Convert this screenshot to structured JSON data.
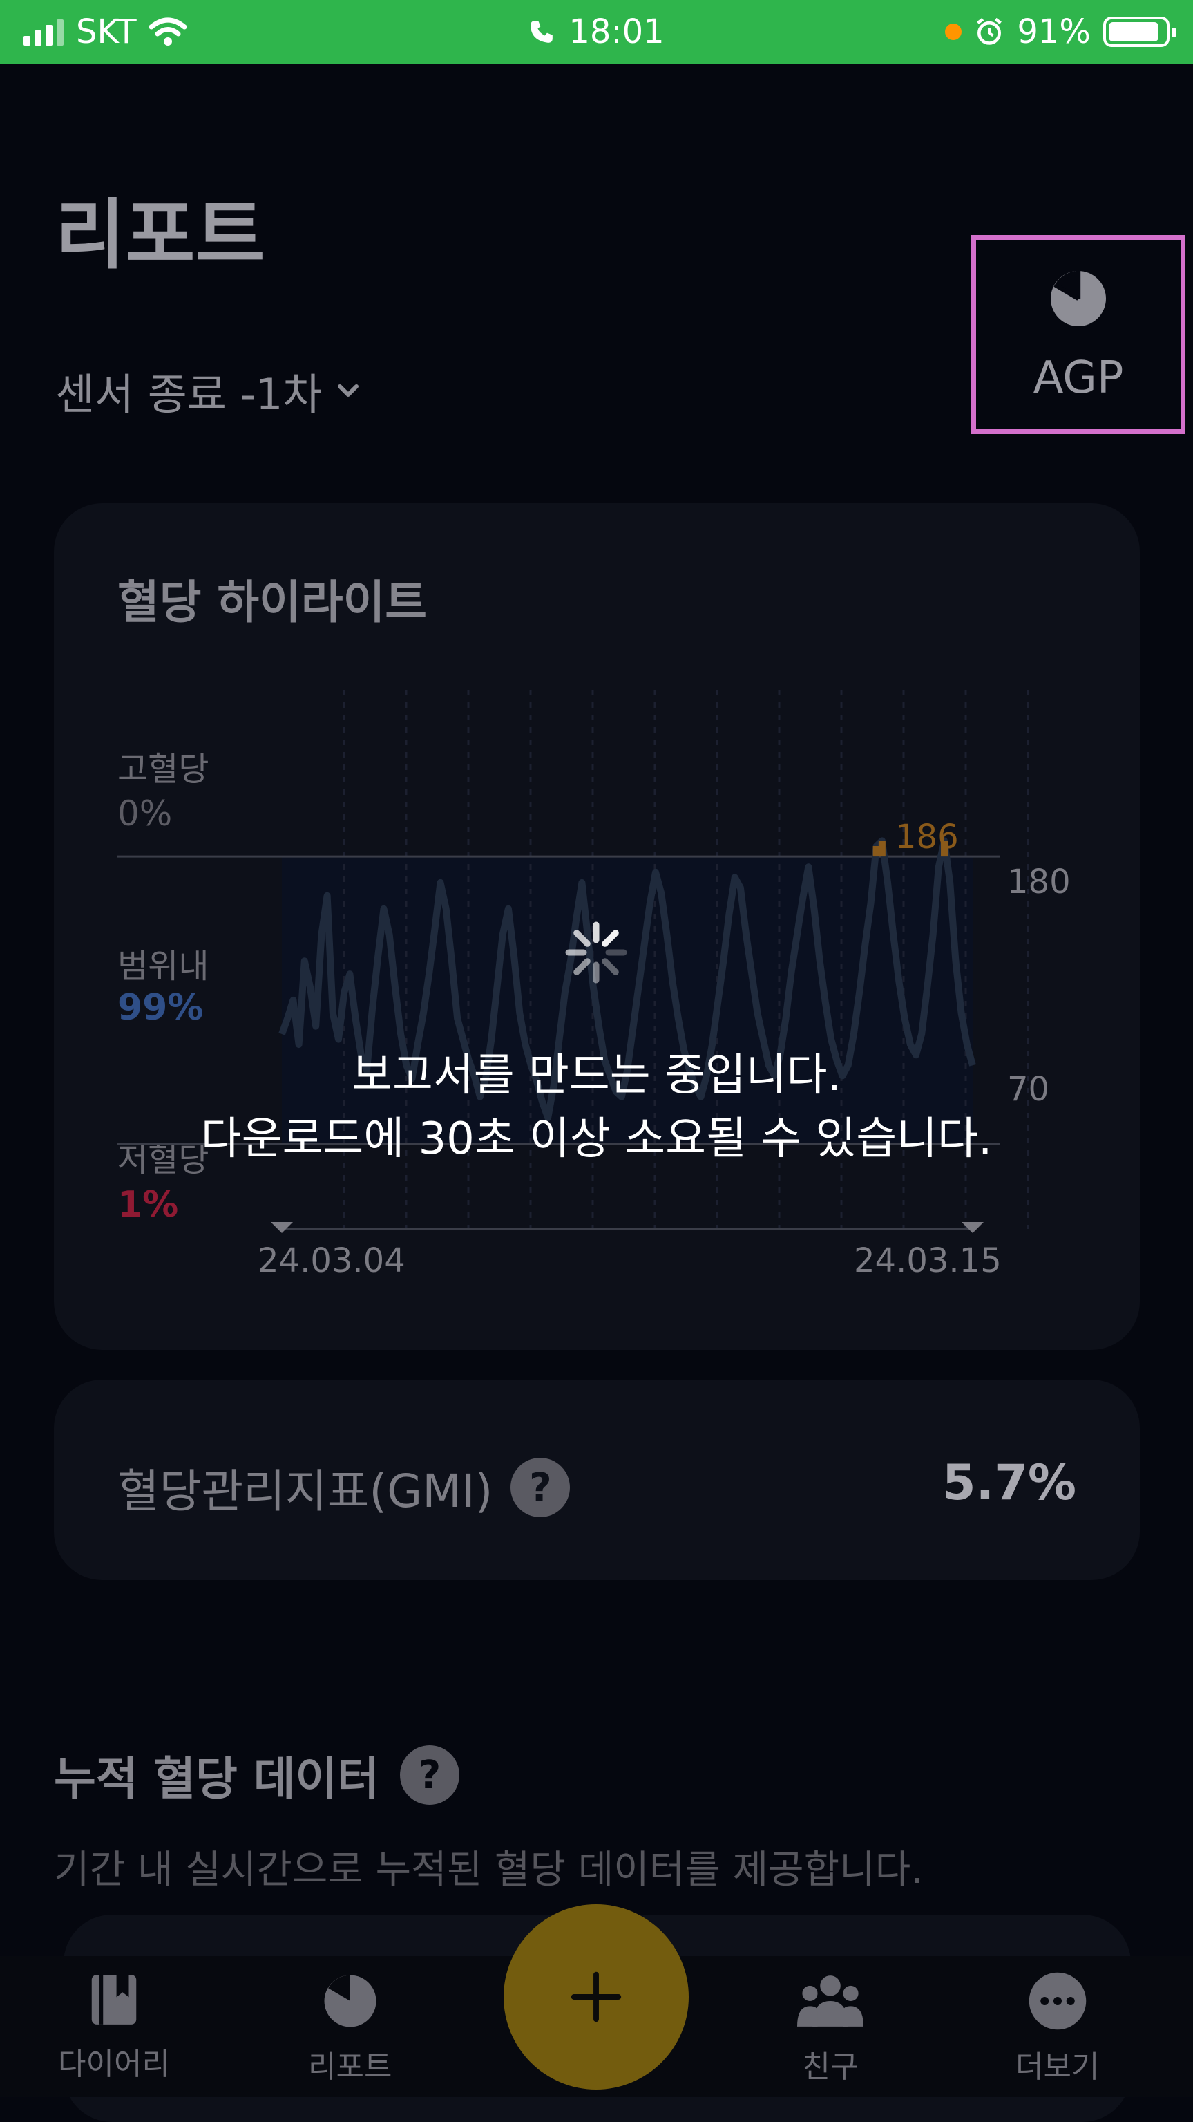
{
  "status_bar": {
    "carrier": "SKT",
    "time": "18:01",
    "battery": "91%"
  },
  "header": {
    "title": "리포트",
    "period": "센서 종료 -1차",
    "agp_label": "AGP"
  },
  "highlight": {
    "title": "혈당 하이라이트",
    "high_label": "고혈당",
    "high_value": "0%",
    "in_range_label": "범위내",
    "in_range_value": "99%",
    "low_label": "저혈당",
    "low_value": "1%",
    "upper_line": "180",
    "lower_line": "70",
    "peak_label": "186",
    "start_date": "24.03.04",
    "end_date": "24.03.15",
    "colors": {
      "in_range": "#2f4f88",
      "low": "#8f1a33",
      "peak": "#8a5a1a"
    }
  },
  "chart_data": {
    "type": "line",
    "title": "혈당 하이라이트",
    "x_range": [
      "24.03.04",
      "24.03.15"
    ],
    "reference_lines": [
      180,
      70
    ],
    "annotations": [
      "186"
    ],
    "values": [
      112,
      118,
      125,
      108,
      140,
      130,
      115,
      150,
      165,
      120,
      110,
      128,
      135,
      118,
      104,
      98,
      122,
      142,
      160,
      150,
      130,
      112,
      100,
      95,
      108,
      120,
      135,
      152,
      170,
      160,
      140,
      118,
      110,
      102,
      96,
      88,
      95,
      110,
      130,
      150,
      160,
      142,
      120,
      108,
      100,
      94,
      86,
      80,
      92,
      110,
      128,
      140,
      156,
      170,
      150,
      130,
      115,
      102,
      96,
      90,
      88,
      98,
      114,
      130,
      146,
      162,
      174,
      166,
      150,
      132,
      118,
      106,
      98,
      92,
      88,
      96,
      108,
      124,
      140,
      158,
      172,
      168,
      150,
      135,
      120,
      110,
      100,
      96,
      104,
      118,
      136,
      150,
      164,
      176,
      160,
      140,
      124,
      110,
      102,
      96,
      100,
      112,
      128,
      146,
      162,
      184,
      186,
      170,
      150,
      132,
      118,
      108,
      104,
      112,
      130,
      150,
      176,
      186,
      170,
      140,
      120,
      108,
      100
    ]
  },
  "overlay": {
    "line1": "보고서를 만드는 중입니다.",
    "line2": "다운로드에 30초 이상 소요될 수 있습니다."
  },
  "gmi": {
    "label": "혈당관리지표(GMI)",
    "value": "5.7%",
    "help": "?"
  },
  "cumulative": {
    "title": "누적 혈당 데이터",
    "help": "?",
    "description": "기간 내 실시간으로 누적된 혈당 데이터를 제공합니다."
  },
  "tabbar": {
    "diary": "다이어리",
    "report": "리포트",
    "friends": "친구",
    "more": "더보기"
  }
}
